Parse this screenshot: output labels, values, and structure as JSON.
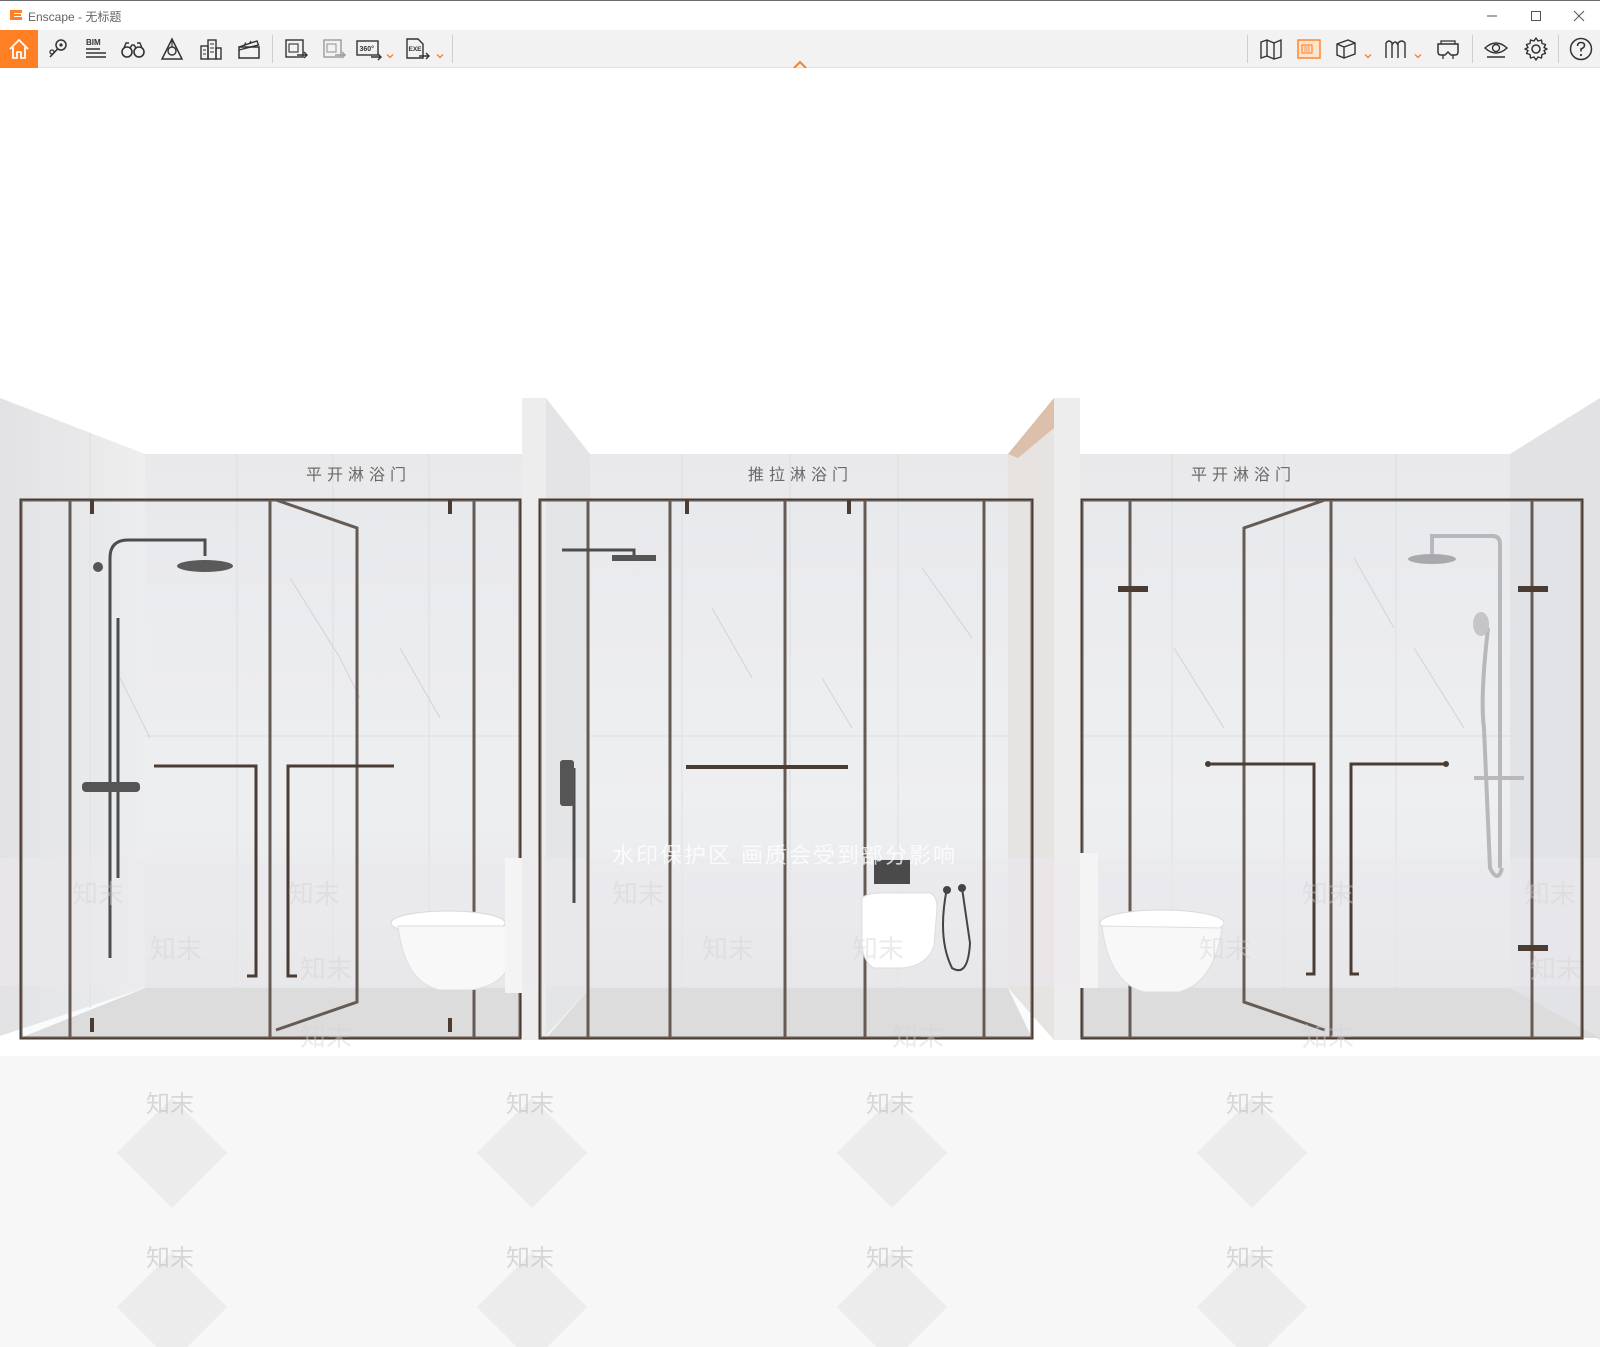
{
  "window": {
    "title": "Enscape - 无标题",
    "accent_color": "#ff7f24"
  },
  "toolbar": {
    "left_tools": [
      {
        "icon": "home-icon"
      },
      {
        "icon": "location-pin-icon"
      },
      {
        "icon": "bim-icon",
        "label": "BIM"
      },
      {
        "icon": "binoculars-icon"
      },
      {
        "icon": "light-view-icon"
      },
      {
        "icon": "building-icon"
      },
      {
        "icon": "clapperboard-icon"
      },
      {
        "icon": "screenshot-export-icon"
      },
      {
        "icon": "batch-render-icon"
      },
      {
        "icon": "panorama-icon",
        "label": "360°"
      },
      {
        "icon": "exe-export-icon",
        "label": "EXE"
      }
    ],
    "right_tools": [
      {
        "icon": "map-icon"
      },
      {
        "icon": "material-library-icon"
      },
      {
        "icon": "cube-view-icon"
      },
      {
        "icon": "asset-library-icon"
      },
      {
        "icon": "vr-headset-icon"
      },
      {
        "icon": "visual-settings-eye-icon"
      },
      {
        "icon": "settings-gear-icon"
      },
      {
        "icon": "help-icon"
      }
    ]
  },
  "scene": {
    "booths": [
      {
        "title": "平开淋浴门"
      },
      {
        "title": "推拉淋浴门"
      },
      {
        "title": "平开淋浴门"
      }
    ],
    "watermark_text": "知末",
    "protection_notice": "水印保护区 画质会受到部分影响"
  }
}
